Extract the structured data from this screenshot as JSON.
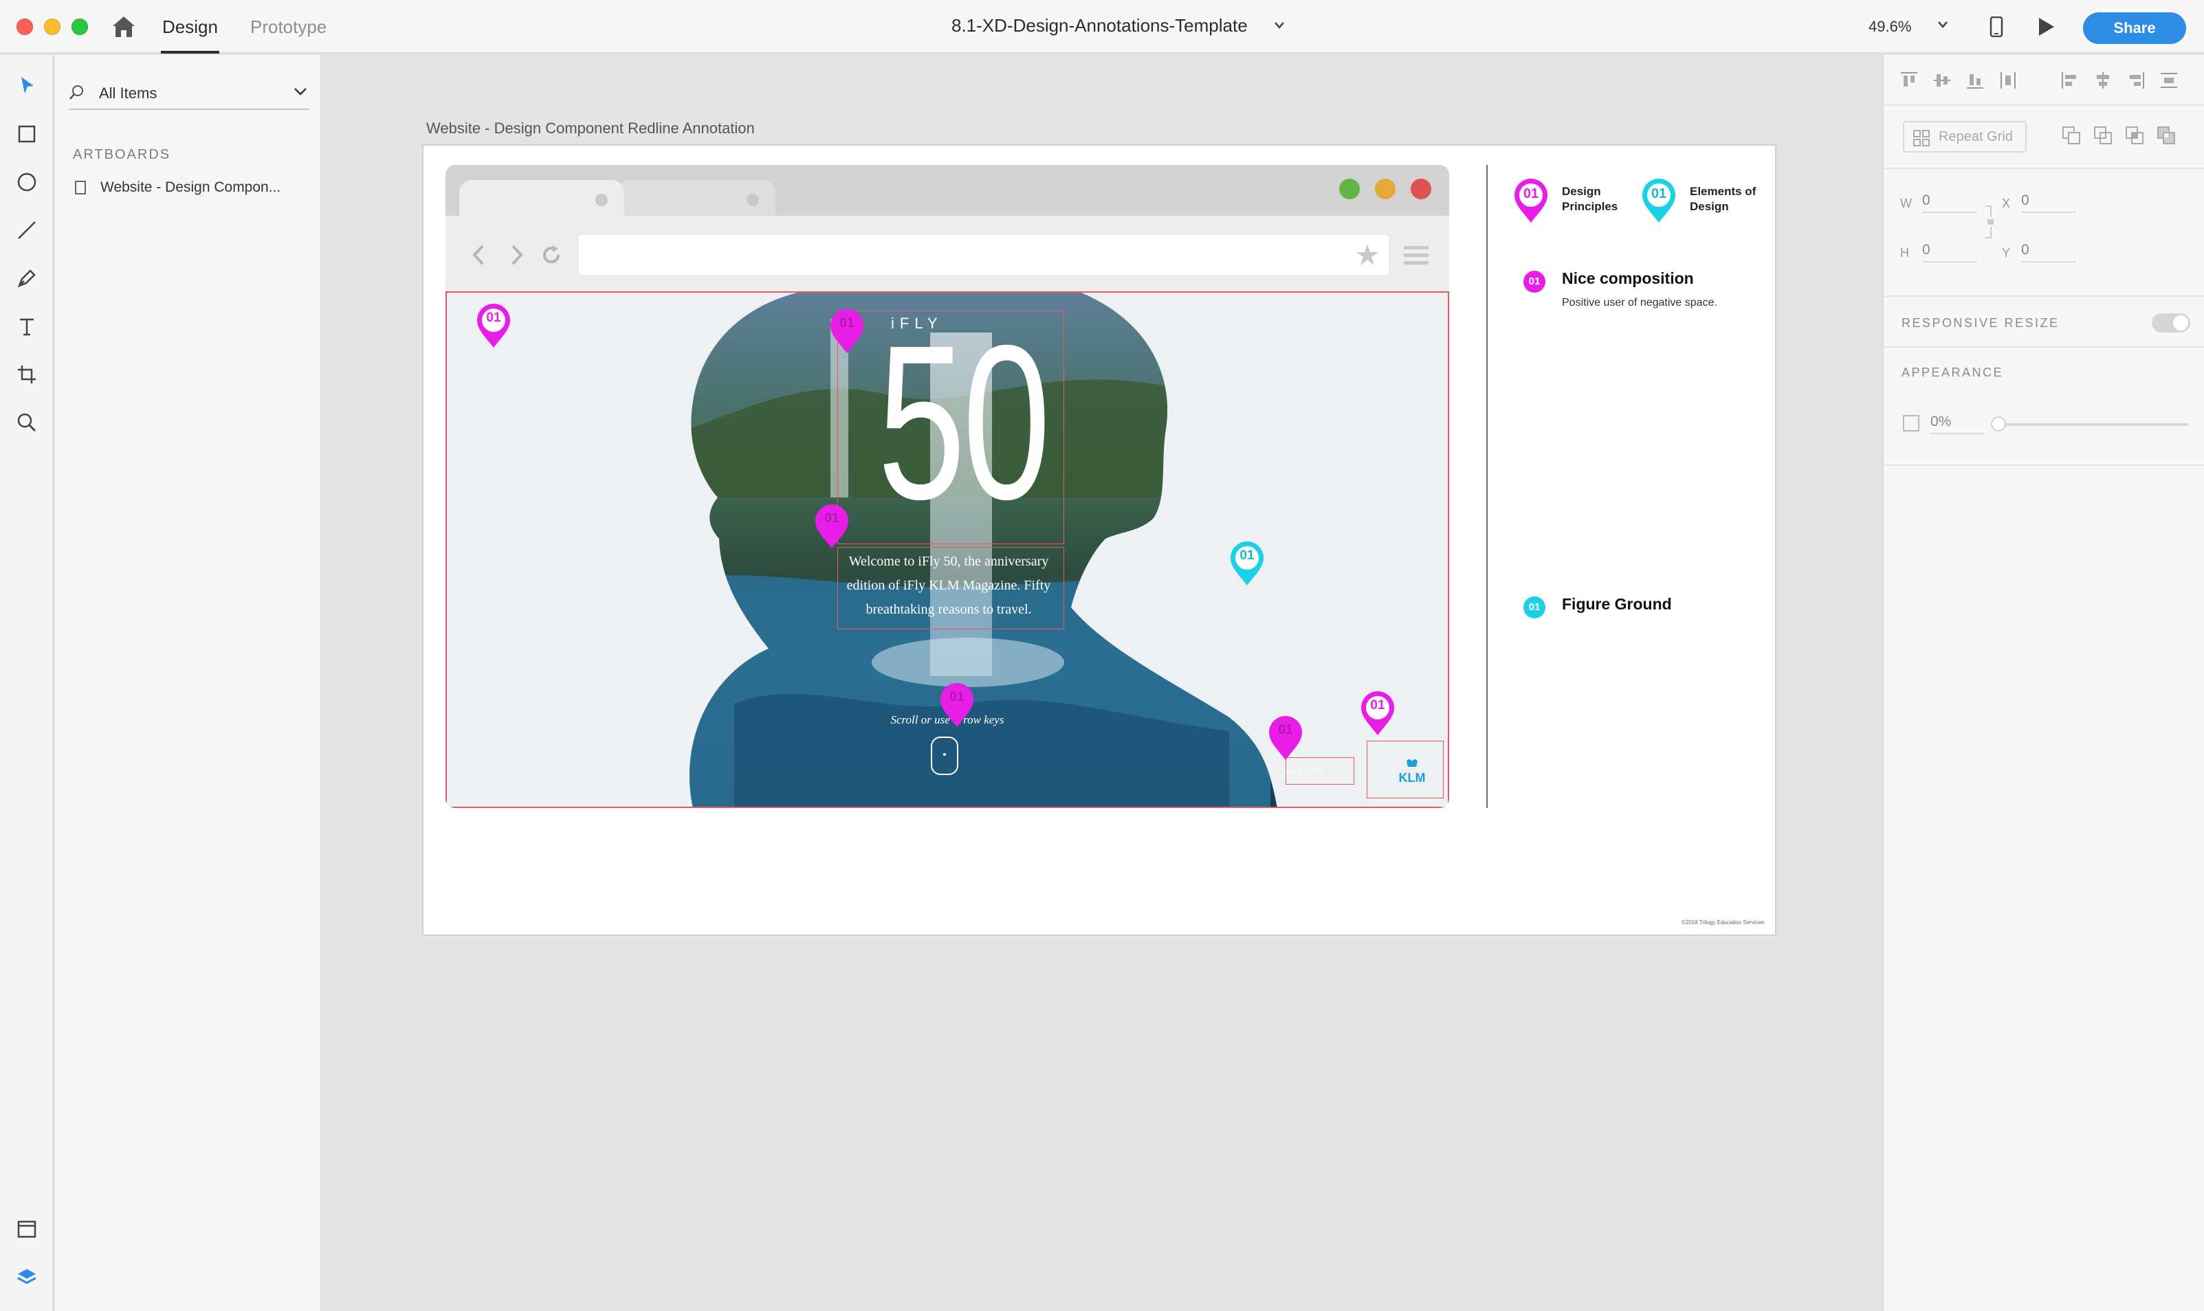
{
  "window": {
    "tabs": [
      {
        "label": "Design",
        "active": true
      },
      {
        "label": "Prototype",
        "active": false
      }
    ],
    "doc_title": "8.1-XD-Design-Annotations-Template",
    "zoom": "49.6%",
    "share_label": "Share"
  },
  "tools": [
    "select-icon",
    "rectangle-icon",
    "ellipse-icon",
    "line-icon",
    "pen-icon",
    "text-icon",
    "artboard-icon",
    "zoom-icon",
    "assets-icon",
    "layers-icon"
  ],
  "layers_panel": {
    "filter": "All Items",
    "artboards_header": "ARTBOARDS",
    "artboards": [
      "Website - Design Compon..."
    ]
  },
  "canvas": {
    "artboard_title": "Website - Design Component Redline Annotation",
    "mock": {
      "brand": "iFLY",
      "issue_number": "50",
      "copy": "Welcome to iFly 50, the anniversary edition of iFly KLM Magazine. Fifty breathtaking reasons to travel.",
      "scroll_hint": "Scroll or use arrow keys",
      "language": "ENGLISH",
      "logo_text": "KLM"
    },
    "pin_label": "01",
    "legend": {
      "principles": "Design Principles",
      "principles_l1": "Design",
      "principles_l2": "Principles",
      "elements": "Elements of Design",
      "elements_l1": "Elements of",
      "elements_l2": "Design"
    },
    "notes": [
      {
        "num": "01",
        "title": "Nice composition",
        "subtitle": "Positive user of negative space.",
        "category": "Design Principles"
      },
      {
        "num": "01",
        "title": "Figure Ground",
        "subtitle": "",
        "category": "Elements of Design"
      }
    ],
    "footer": "©2018 Trilogy Education Services"
  },
  "inspector": {
    "repeat_grid": "Repeat Grid",
    "w_label": "W",
    "w_value": "0",
    "h_label": "H",
    "h_value": "0",
    "x_label": "X",
    "x_value": "0",
    "y_label": "Y",
    "y_value": "0",
    "responsive_resize": "RESPONSIVE RESIZE",
    "appearance": "APPEARANCE",
    "opacity": "0%",
    "responsive_on": false
  },
  "colors": {
    "magenta": "#e81ee8",
    "cyan": "#1ad1e6",
    "redline": "#e8585e",
    "share_blue": "#2d8ce3"
  }
}
